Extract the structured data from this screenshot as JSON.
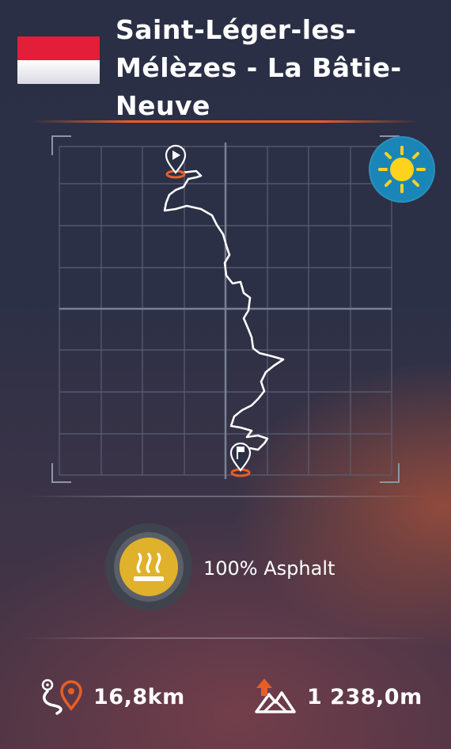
{
  "header": {
    "title": "Saint-Léger-les-Mélèzes - La Bâtie-Neuve",
    "flag": {
      "colors": [
        "#e31e38",
        "#ffffff"
      ]
    }
  },
  "weather": {
    "icon": "sun-icon",
    "color": "#1a86b8"
  },
  "map": {
    "start_icon": "start-pin-icon",
    "finish_icon": "finish-pin-icon",
    "route_color": "#ffffff",
    "marker_color": "#e85e26"
  },
  "surface": {
    "label": "100% Asphalt",
    "icon": "asphalt-heat-icon"
  },
  "stats": {
    "distance": {
      "value": "16,8km",
      "icon": "distance-route-icon"
    },
    "elevation": {
      "value": "1 238,0m",
      "icon": "elevation-mountain-icon"
    }
  }
}
